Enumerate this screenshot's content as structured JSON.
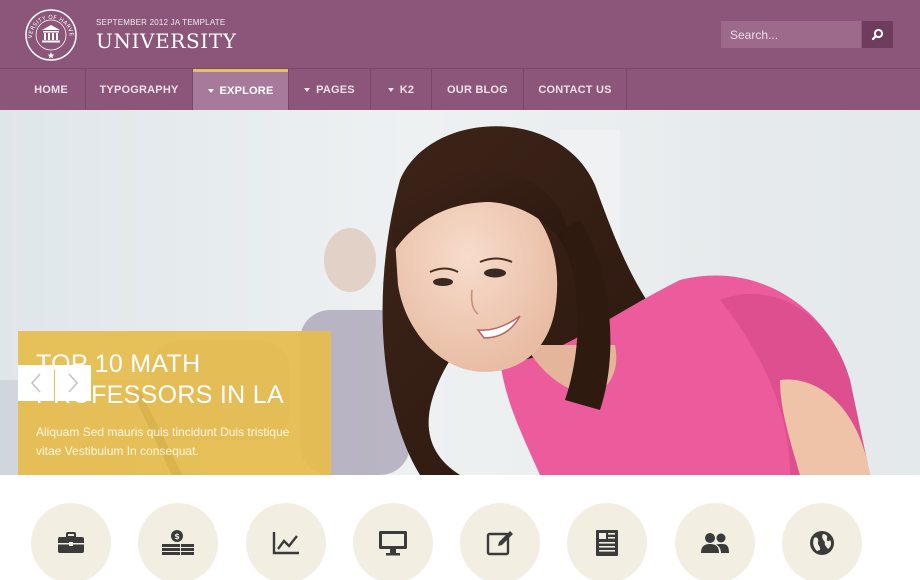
{
  "header": {
    "subtitle": "SEPTEMBER 2012 JA TEMPLATE",
    "title": "UNIVERSITY",
    "logo_text": "UNIVERSITY OF HARVERDE",
    "search_placeholder": "Search..."
  },
  "nav": {
    "items": [
      {
        "label": "HOME",
        "dropdown": false,
        "active": false
      },
      {
        "label": "TYPOGRAPHY",
        "dropdown": false,
        "active": false
      },
      {
        "label": "EXPLORE",
        "dropdown": true,
        "active": true
      },
      {
        "label": "PAGES",
        "dropdown": true,
        "active": false
      },
      {
        "label": "K2",
        "dropdown": true,
        "active": false
      },
      {
        "label": "OUR BLOG",
        "dropdown": false,
        "active": false
      },
      {
        "label": "CONTACT US",
        "dropdown": false,
        "active": false
      }
    ]
  },
  "hero": {
    "title": "TOP 10 MATH PROFESSORS IN LA",
    "text": "Aliquam Sed mauris quis tincidunt Duis tristique vitae Vestibulum In consequat.",
    "prev_icon": "chevron-left-icon",
    "next_icon": "chevron-right-icon"
  },
  "features": [
    {
      "icon": "briefcase-icon"
    },
    {
      "icon": "money-icon"
    },
    {
      "icon": "chart-icon"
    },
    {
      "icon": "monitor-icon"
    },
    {
      "icon": "edit-icon"
    },
    {
      "icon": "newspaper-icon"
    },
    {
      "icon": "users-icon"
    },
    {
      "icon": "globe-icon"
    }
  ],
  "colors": {
    "header_bg": "#8b5679",
    "nav_active": "#a7799a",
    "accent": "#e4c15a",
    "caption_bg": "#e6bc4e",
    "feature_bg": "#f2eee2"
  }
}
